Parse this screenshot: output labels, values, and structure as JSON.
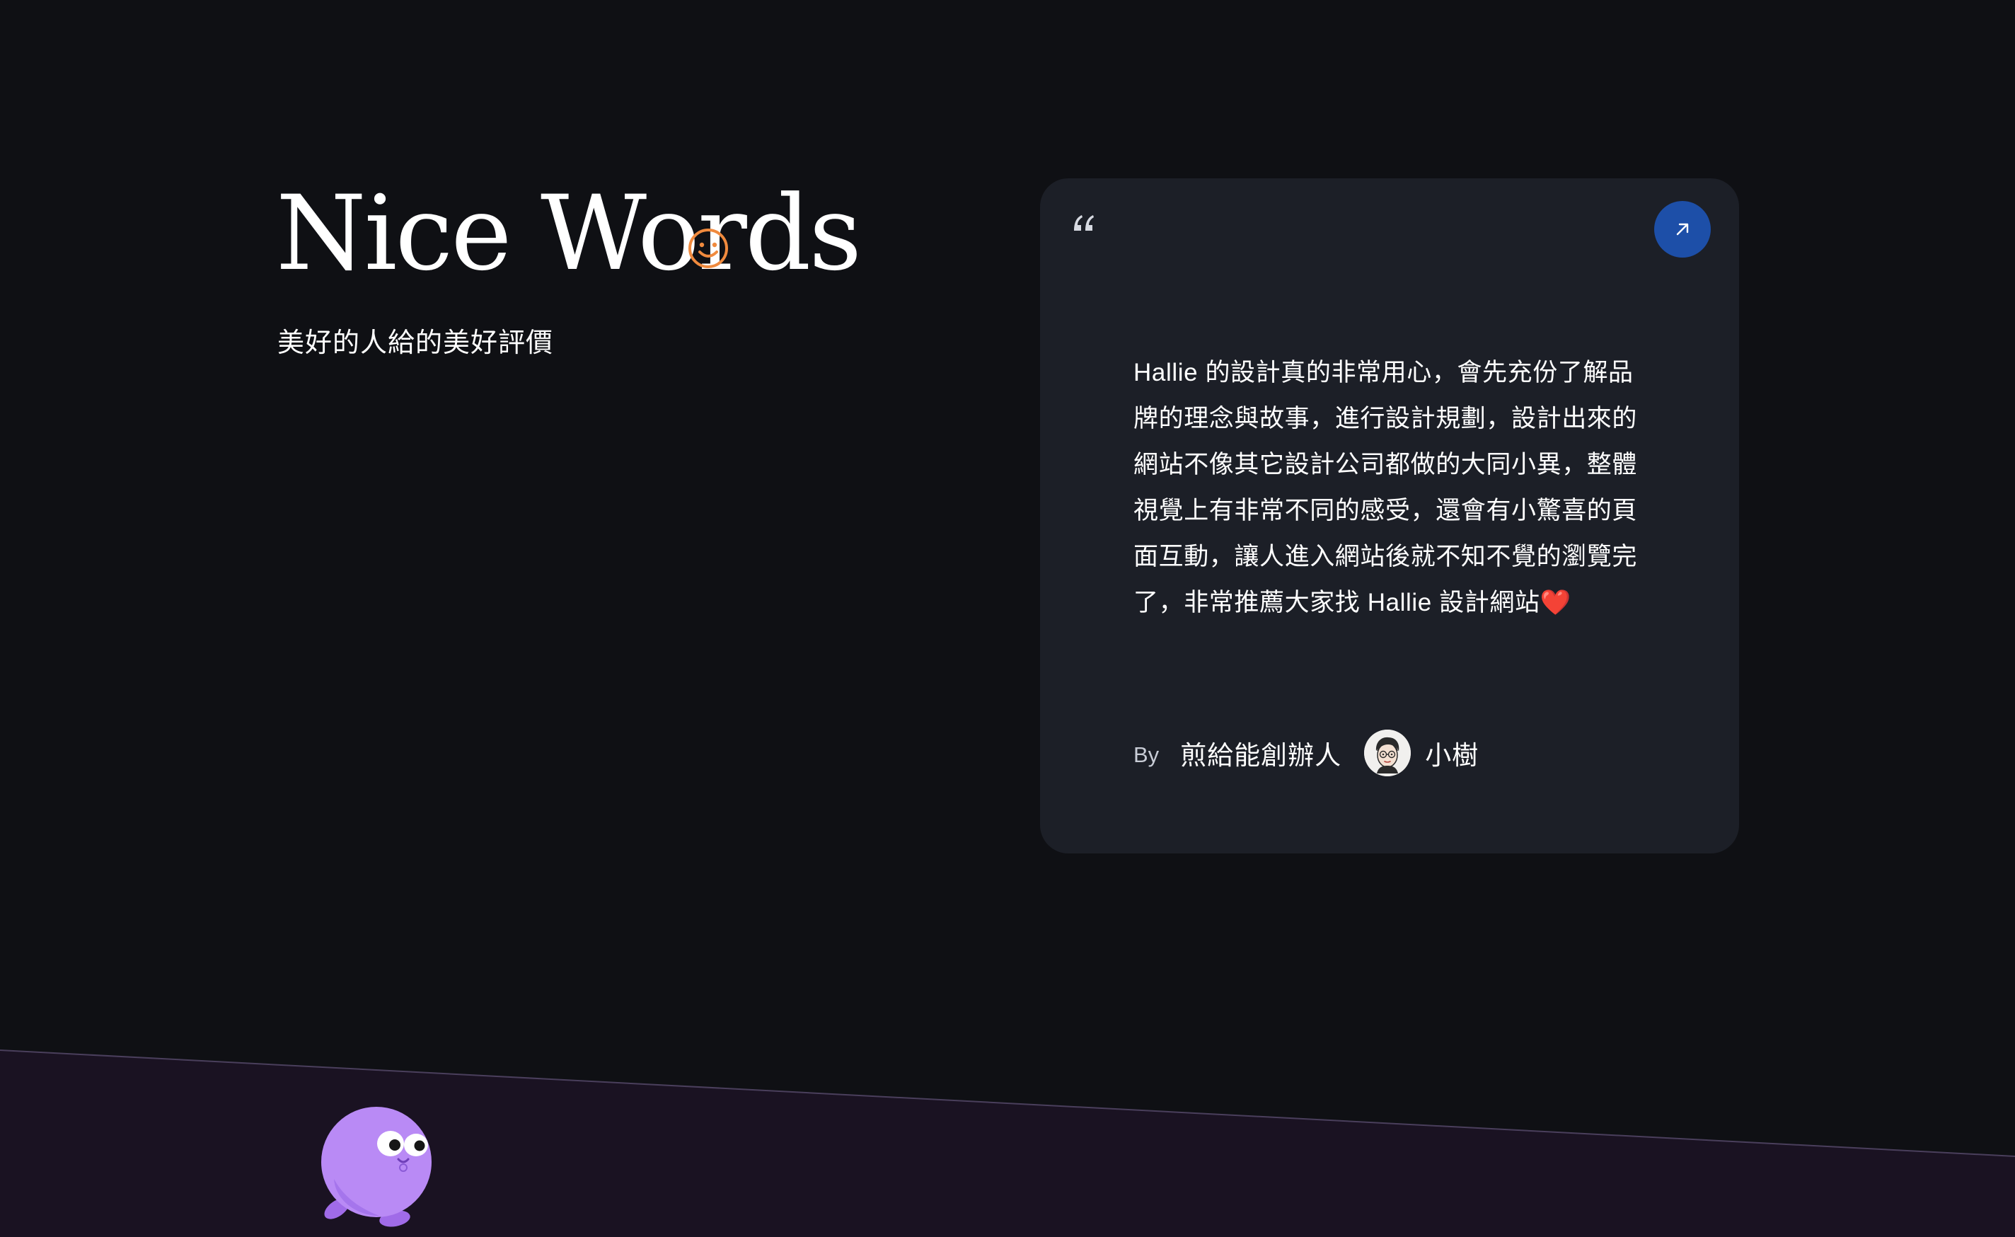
{
  "heading": {
    "title": "Nice Words",
    "subtitle": "美好的人給的美好評價"
  },
  "testimonial": {
    "text": "Hallie 的設計真的非常用心，會先充份了解品牌的理念與故事，進行設計規劃，設計出來的網站不像其它設計公司都做的大同小異，整體視覺上有非常不同的感受，還會有小驚喜的頁面互動，讓人進入網站後就不知不覺的瀏覽完了，非常推薦大家找 Hallie 設計網站❤️",
    "by_label": "By",
    "author_role": "煎給能創辦人",
    "author_name": "小樹"
  },
  "icons": {
    "title_accent": "smile-icon",
    "quote": "quote-icon",
    "link": "arrow-up-right-icon",
    "mascot": "purple-blob-mascot"
  },
  "colors": {
    "background": "#0f1014",
    "card": "#1c1f27",
    "accent_button": "#1d4fa8",
    "smile": "#f08a3e",
    "band": "#1a1222",
    "mascot": "#b98af5"
  }
}
